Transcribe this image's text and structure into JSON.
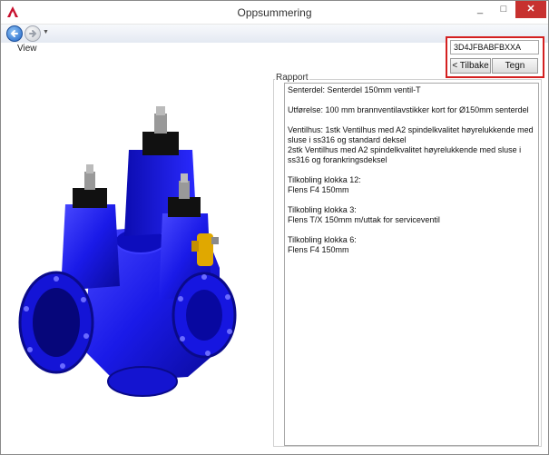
{
  "window": {
    "title": "Oppsummering",
    "app_icon": "autocad-logo-icon",
    "controls": {
      "minimize": "_",
      "maximize": "□",
      "close": "✕"
    }
  },
  "nav": {
    "back_icon": "back-arrow-icon",
    "forward_icon": "forward-arrow-icon"
  },
  "menu": {
    "view_label": "View"
  },
  "code_panel": {
    "code_value": "3D4JFBABFBXXA",
    "back_label": "< Tilbake",
    "draw_label": "Tegn",
    "highlight_color": "#d42020"
  },
  "viewer": {
    "image": "blue-valve-assembly-3d-model",
    "body_color": "#1a1aff",
    "accent_color": "#e0a800"
  },
  "report": {
    "group_label": "Rapport",
    "lines": [
      "Senterdel: Senterdel 150mm ventil-T",
      "",
      "Utførelse: 100 mm brannventilavstikker kort for Ø150mm senterdel",
      "",
      "Ventilhus: 1stk Ventilhus med A2 spindelkvalitet høyrelukkende med sluse i ss316 og standard deksel",
      "2stk Ventilhus med A2 spindelkvalitet høyrelukkende med sluse i ss316 og forankringsdeksel",
      "",
      "Tilkobling klokka 12:",
      "Flens F4 150mm",
      "",
      "Tilkobling klokka 3:",
      "Flens T/X 150mm m/uttak for serviceventil",
      "",
      "Tilkobling klokka 6:",
      "Flens F4 150mm"
    ]
  }
}
